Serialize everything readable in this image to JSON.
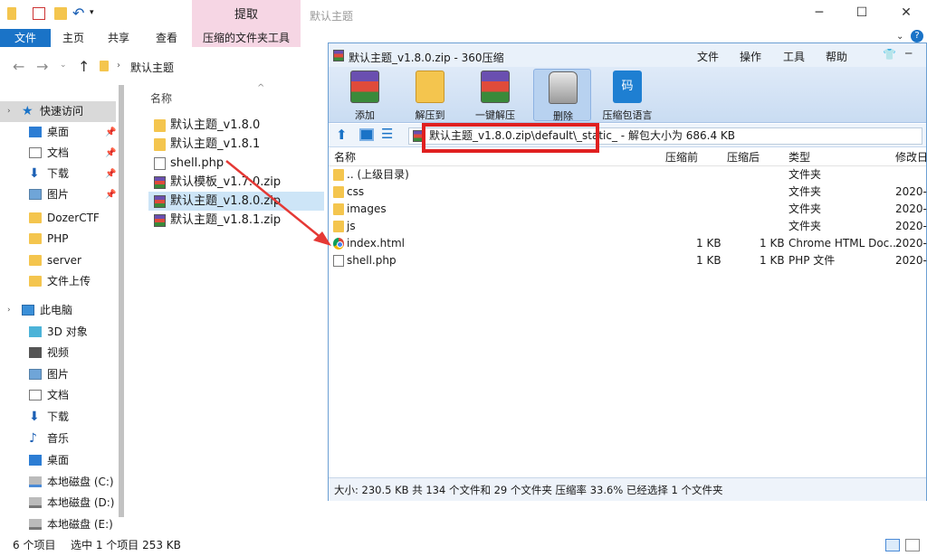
{
  "explorer": {
    "title": "默认主题",
    "context_tab_header": "提取",
    "ribbon_tabs": [
      "文件",
      "主页",
      "共享",
      "查看",
      "压缩的文件夹工具"
    ],
    "breadcrumb": "默认主题",
    "column_name": "名称",
    "nav": {
      "quick_access": "快速访问",
      "quick_items": [
        "桌面",
        "文档",
        "下载",
        "图片",
        "DozerCTF",
        "PHP",
        "server",
        "文件上传"
      ],
      "this_pc": "此电脑",
      "pc_items": [
        "3D 对象",
        "视频",
        "图片",
        "文档",
        "下载",
        "音乐",
        "桌面",
        "本地磁盘 (C:)",
        "本地磁盘 (D:)",
        "本地磁盘 (E:)"
      ]
    },
    "files": [
      "默认主题_v1.8.0",
      "默认主题_v1.8.1",
      "shell.php",
      "默认模板_v1.7.0.zip",
      "默认主题_v1.8.0.zip",
      "默认主题_v1.8.1.zip"
    ],
    "status": {
      "count": "6 个项目",
      "selected": "选中 1 个项目 253 KB"
    }
  },
  "zip": {
    "title": "默认主题_v1.8.0.zip - 360压缩",
    "menu": [
      "文件",
      "操作",
      "工具",
      "帮助"
    ],
    "tools": [
      "添加",
      "解压到",
      "一键解压",
      "删除",
      "压缩包语言"
    ],
    "path": "默认主题_v1.8.0.zip\\default\\_static_",
    "unpack_size": "- 解包大小为 686.4 KB",
    "columns": {
      "name": "名称",
      "compressed": "压缩前",
      "after": "压缩后",
      "type": "类型",
      "modified": "修改日"
    },
    "rows": [
      {
        "name": ".. (上级目录)",
        "before": "",
        "after": "",
        "type": "文件夹",
        "date": ""
      },
      {
        "name": "css",
        "before": "",
        "after": "",
        "type": "文件夹",
        "date": "2020-0"
      },
      {
        "name": "images",
        "before": "",
        "after": "",
        "type": "文件夹",
        "date": "2020-0"
      },
      {
        "name": "js",
        "before": "",
        "after": "",
        "type": "文件夹",
        "date": "2020-0"
      },
      {
        "name": "index.html",
        "before": "1 KB",
        "after": "1 KB",
        "type": "Chrome HTML Doc...",
        "date": "2020-0"
      },
      {
        "name": "shell.php",
        "before": "1 KB",
        "after": "1 KB",
        "type": "PHP 文件",
        "date": "2020-0"
      }
    ],
    "status": "大小: 230.5 KB 共 134 个文件和 29 个文件夹 压缩率 33.6% 已经选择 1 个文件夹"
  }
}
